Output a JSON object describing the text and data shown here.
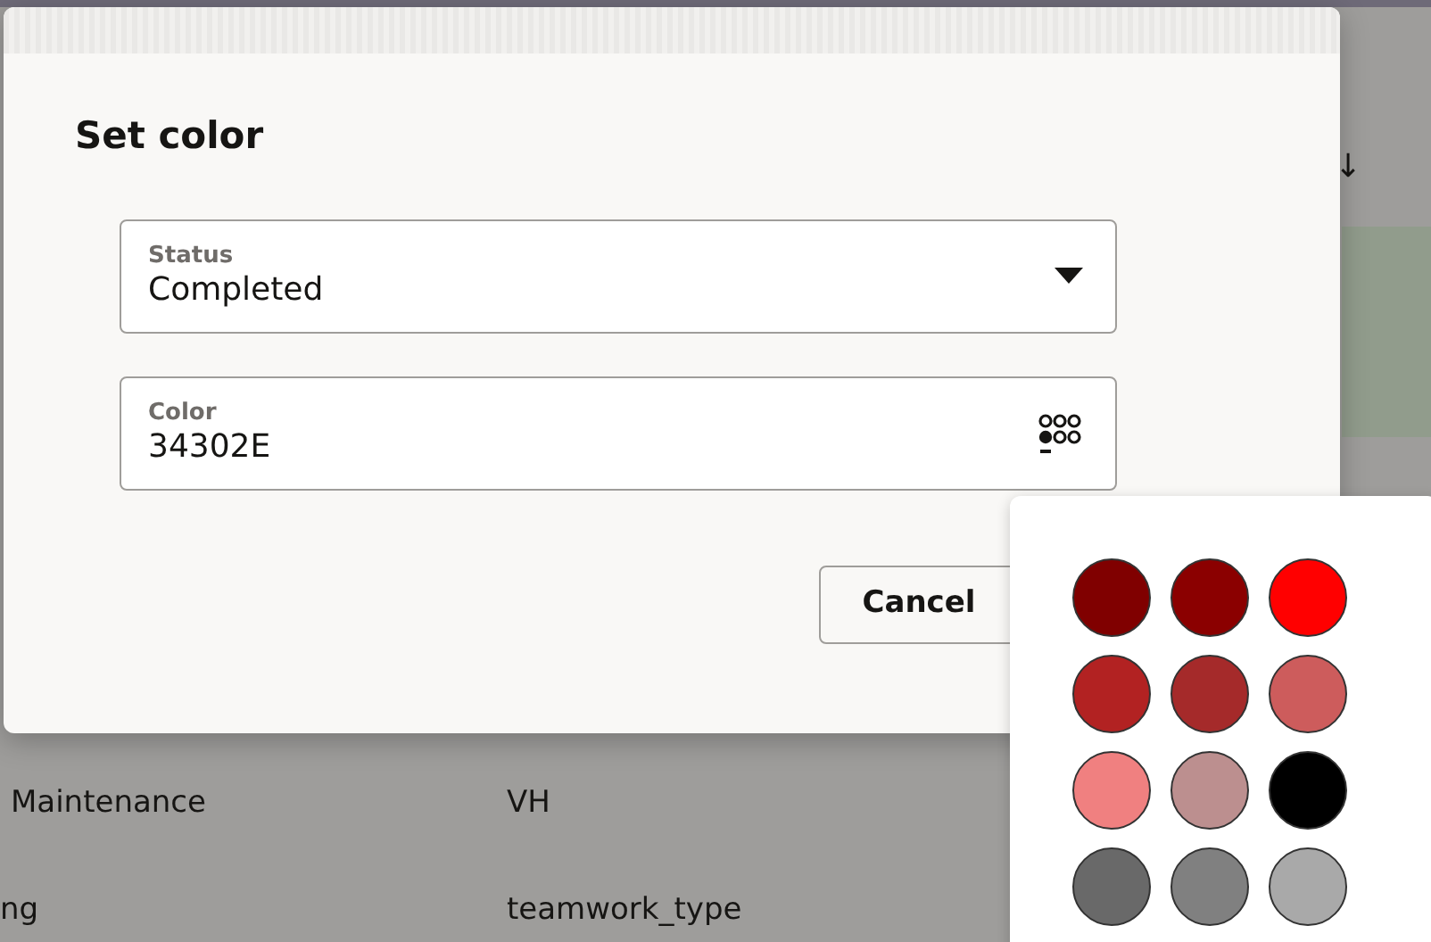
{
  "background": {
    "sort_indicator": "↓",
    "rows": [
      {
        "column_1": "Maintenance",
        "column_2": "VH"
      },
      {
        "column_1": "ng",
        "column_2": "teamwork_type"
      }
    ]
  },
  "dialog": {
    "title": "Set color",
    "fields": [
      {
        "kind": "select",
        "label": "Status",
        "value": "Completed"
      },
      {
        "kind": "color",
        "label": "Color",
        "value": "34302E"
      }
    ],
    "buttons": [
      "Cancel"
    ]
  },
  "palette": {
    "swatches": [
      {
        "color": "#800000"
      },
      {
        "color": "#8b0000"
      },
      {
        "color": "#ff0000"
      },
      {
        "color": "#b22222"
      },
      {
        "color": "#a52a2a"
      },
      {
        "color": "#cd5c5c"
      },
      {
        "color": "#f08080"
      },
      {
        "color": "#bc8f8f"
      },
      {
        "color": "#000000"
      },
      {
        "color": "#696969"
      },
      {
        "color": "#808080"
      },
      {
        "color": "#a9a9a9"
      }
    ]
  }
}
